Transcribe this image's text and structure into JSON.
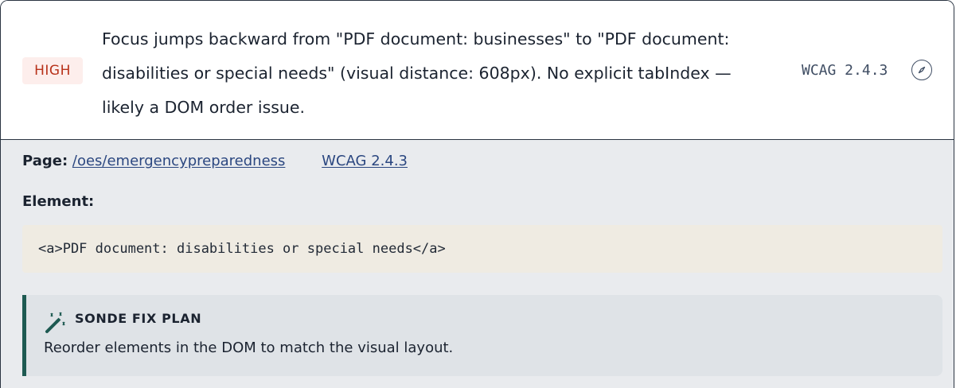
{
  "issue": {
    "severity": "HIGH",
    "summary": "Focus jumps backward from \"PDF document: businesses\" to \"PDF document: disabilities or special needs\" (visual distance: 608px). No explicit tabIndex — likely a DOM order issue.",
    "wcag_chip": "WCAG 2.4.3",
    "toggle_icon": "compass-icon"
  },
  "details": {
    "page_label": "Page:",
    "page_link": "/oes/emergencypreparedness",
    "wcag_link": "WCAG 2.4.3",
    "element_label": "Element:",
    "element_code": "<a>PDF document: disabilities or special needs</a>"
  },
  "fix_plan": {
    "icon": "magic-wand-icon",
    "title": "SONDE FIX PLAN",
    "body": "Reorder elements in the DOM to match the visual layout."
  },
  "colors": {
    "severity_text": "#b8321a",
    "severity_bg": "#fdeeec",
    "link": "#2b4780",
    "fix_accent": "#1e5a52",
    "code_bg": "#efebe2"
  }
}
